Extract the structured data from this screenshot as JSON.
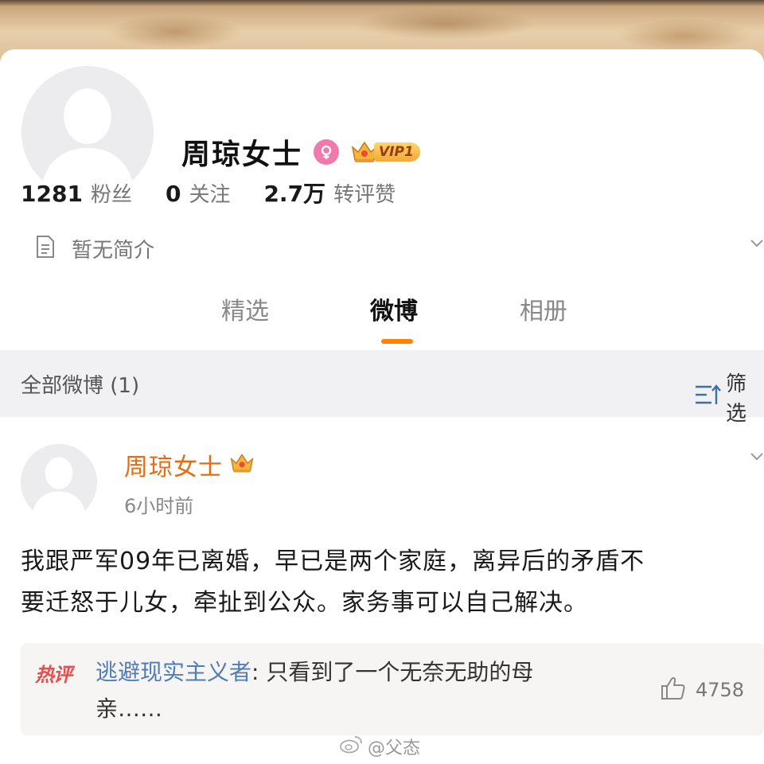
{
  "profile": {
    "name": "周琼女士",
    "vip_label": "VIP1",
    "stats": [
      {
        "value": "1281",
        "label": "粉丝"
      },
      {
        "value": "0",
        "label": "关注"
      },
      {
        "value": "2.7万",
        "label": "转评赞"
      }
    ],
    "bio": "暂无简介"
  },
  "tabs": [
    {
      "label": "精选",
      "active": false
    },
    {
      "label": "微博",
      "active": true
    },
    {
      "label": "相册",
      "active": false
    }
  ],
  "filter": {
    "title": "全部微博 (1)",
    "button_label": "筛选"
  },
  "post": {
    "author": "周琼女士",
    "time": "6小时前",
    "body_line1": "我跟严军09年已离婚，早已是两个家庭，离异后的矛盾不",
    "body_line2": "要迁怒于儿女，牵扯到公众。家务事可以自己解决。",
    "hot_comment": {
      "tag": "热评",
      "author": "逃避现实主义者",
      "separator": ": ",
      "text_line1": "只看到了一个无奈无助的母",
      "text_line2": "亲……",
      "likes": "4758"
    }
  },
  "watermark": "@父态",
  "colors": {
    "accent": "#ff8200",
    "author_orange": "#e86b10",
    "comment_author_blue": "#4f7db8",
    "hot_tag_red": "#ea4c4c",
    "gender_pink": "#f07aa9"
  }
}
